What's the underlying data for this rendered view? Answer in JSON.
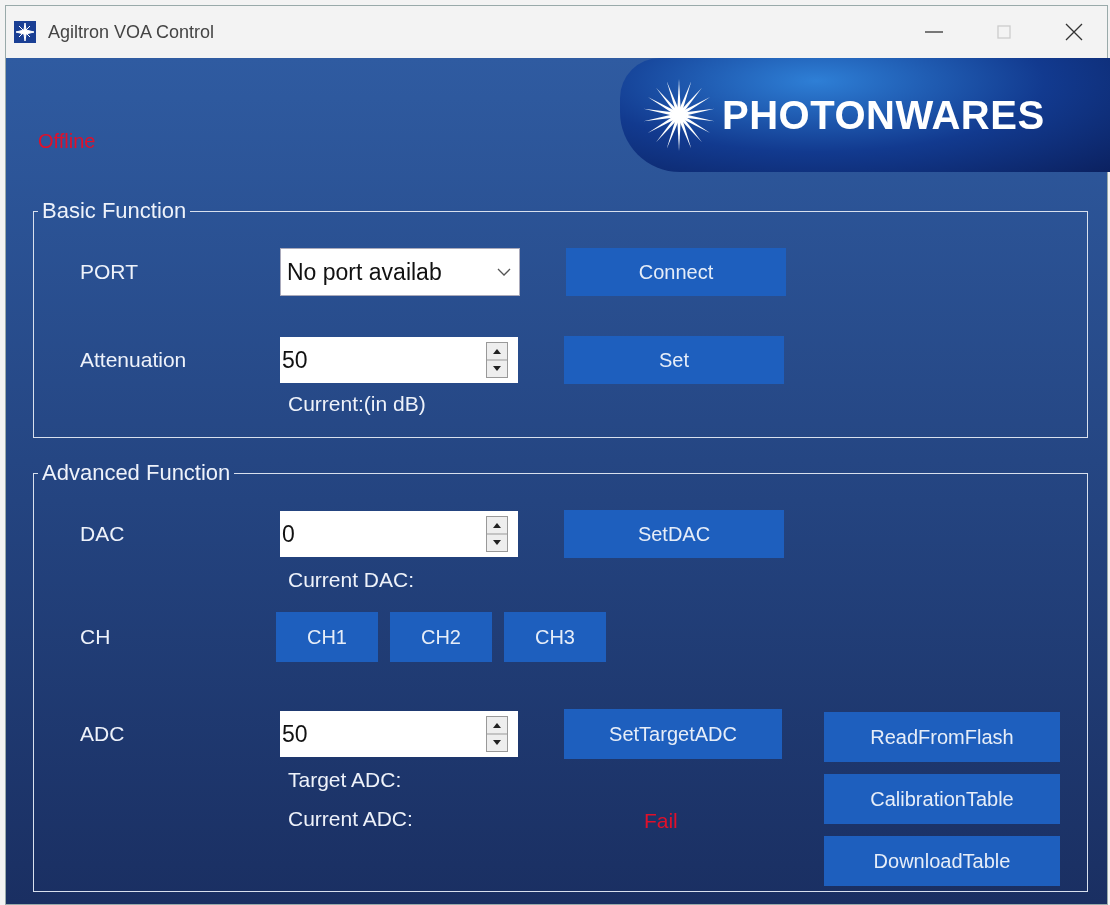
{
  "window": {
    "title": "Agiltron VOA Control"
  },
  "status": {
    "text": "Offline"
  },
  "logo": {
    "text": "PHOTONWARES"
  },
  "basic": {
    "title": "Basic Function",
    "port": {
      "label": "PORT",
      "value": "No port availab",
      "button": "Connect"
    },
    "attenuation": {
      "label": "Attenuation",
      "value": "50",
      "button": "Set",
      "current_label": "Current:(in dB)"
    }
  },
  "advanced": {
    "title": "Advanced Function",
    "dac": {
      "label": "DAC",
      "value": "0",
      "button": "SetDAC",
      "current_label": "Current DAC:"
    },
    "ch": {
      "label": "CH",
      "buttons": [
        "CH1",
        "CH2",
        "CH3"
      ]
    },
    "adc": {
      "label": "ADC",
      "value": "50",
      "button": "SetTargetADC",
      "target_label": "Target ADC:",
      "current_label": "Current ADC:",
      "current_value": "Fail"
    },
    "side_buttons": [
      "ReadFromFlash",
      "CalibrationTable",
      "DownloadTable"
    ]
  }
}
